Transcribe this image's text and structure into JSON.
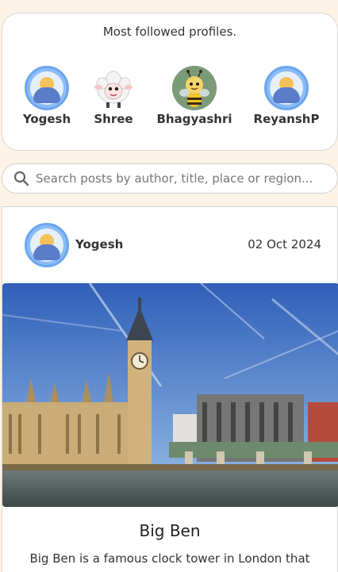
{
  "profiles": {
    "title": "Most followed profiles.",
    "items": [
      {
        "name": "Yogesh",
        "avatar": "default-user-avatar"
      },
      {
        "name": "Shree",
        "avatar": "sheep-avatar"
      },
      {
        "name": "Bhagyashri",
        "avatar": "bee-avatar"
      },
      {
        "name": "ReyanshP",
        "avatar": "default-user-avatar"
      }
    ]
  },
  "search": {
    "placeholder": "Search posts by author, title, place or region..."
  },
  "post": {
    "author": "Yogesh",
    "date": "02 Oct 2024",
    "image": "big-ben-photo",
    "title": "Big Ben",
    "excerpt": "Big Ben is a famous clock tower in London that"
  },
  "colors": {
    "page_background": "#fdf3e6",
    "avatar_blue": "#8cbcf5",
    "card_border": "#d8d8d8"
  }
}
